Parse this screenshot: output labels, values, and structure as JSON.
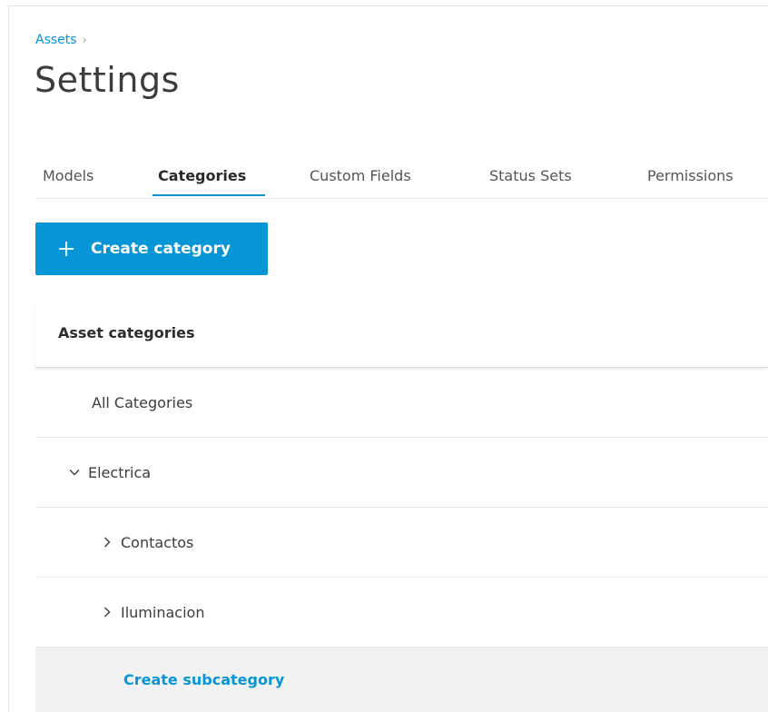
{
  "breadcrumb": {
    "items": [
      "Assets"
    ],
    "separator": "›"
  },
  "page": {
    "title": "Settings"
  },
  "tabs": [
    {
      "label": "Models",
      "active": false
    },
    {
      "label": "Categories",
      "active": true
    },
    {
      "label": "Custom Fields",
      "active": false
    },
    {
      "label": "Status Sets",
      "active": false
    },
    {
      "label": "Permissions",
      "active": false
    }
  ],
  "toolbar": {
    "create_label": "Create category",
    "create_icon": "plus-icon"
  },
  "categories": {
    "header": "Asset categories",
    "rows": [
      {
        "label": "All Categories",
        "expander": "none"
      },
      {
        "label": "Electrica",
        "expander": "expanded"
      },
      {
        "label": "Contactos",
        "expander": "collapsed"
      },
      {
        "label": "Iluminacion",
        "expander": "collapsed"
      }
    ],
    "create_sub_label": "Create subcategory"
  },
  "colors": {
    "accent": "#0696d7",
    "text": "#3c3c3c",
    "row_highlight": "#f2f2f2"
  }
}
